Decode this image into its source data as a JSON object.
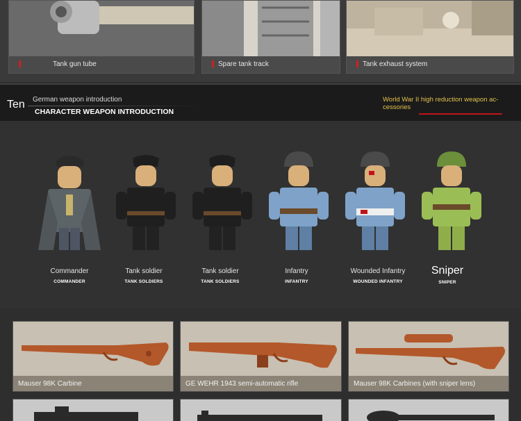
{
  "top_cards": [
    {
      "caption": "Tank gun tube"
    },
    {
      "caption": "Spare tank track"
    },
    {
      "caption": "Tank exhaust system"
    }
  ],
  "header": {
    "number": "Ten",
    "subtitle": "German weapon introduction",
    "title": "CHARACTER WEAPON INTRODUCTION",
    "right_text": "World War II high reduction weapon ac-cessories"
  },
  "characters": [
    {
      "name": "Commander",
      "name_upper": "COMMANDER"
    },
    {
      "name": "Tank soldier",
      "name_upper": "TANK SOLDIERS"
    },
    {
      "name": "Tank soldier",
      "name_upper": "TANK SOLDIERS"
    },
    {
      "name": "Infantry",
      "name_upper": "INFANTRY"
    },
    {
      "name": "Wounded Infantry",
      "name_upper": "WOUNDED INFANTRY"
    },
    {
      "name": "Sniper",
      "name_upper": "SNIPER"
    }
  ],
  "weapons": [
    {
      "caption": "Mauser 98K Carbine"
    },
    {
      "caption": "GE WEHR 1943 semi-automatic rifle"
    },
    {
      "caption": "Mauser 98K Carbines (with sniper lens)"
    }
  ],
  "colors": {
    "accent_red": "#c0141b",
    "accent_gold": "#e3c24a",
    "weapon_brown": "#b3582a"
  }
}
